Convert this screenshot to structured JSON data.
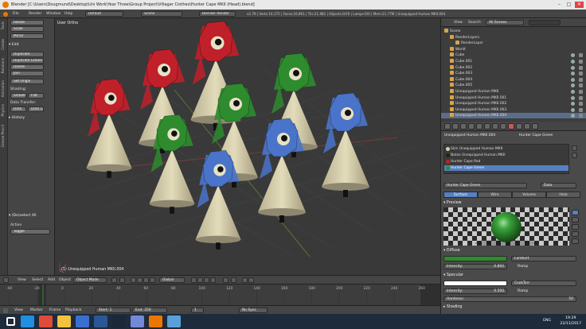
{
  "window": {
    "title": "Blender [C:\\Users\\Dougmund\\Desktop\\Uni Work\\Year Three\\Group Project\\Villager Clothes\\Hunter Cape MKII (Head).blend]",
    "controls": [
      "–",
      "□",
      "✕"
    ]
  },
  "info_header": {
    "menus": [
      "File",
      "Render",
      "Window",
      "Help"
    ],
    "layout": "Default",
    "scene": "Scene",
    "engine": "Blender Render",
    "stats": "v2.79 | Verts:10,175 | Faces:10,961 | Tris:21,981 | Objects:0/19 | Lamps:0/0 | Mem:21.77M | Unequipped Human MKII.004"
  },
  "tool_shelf": {
    "tabs": [
      "Tools",
      "Create",
      "Relations",
      "Animation",
      "Physics",
      "Grease Pencil"
    ],
    "transform_buttons": [
      "Rotate",
      "Scale",
      "Mirror"
    ],
    "edit_section": "▾ Edit",
    "edit_buttons": [
      "Duplicate",
      "Duplicate Linked",
      "Delete",
      "Join"
    ],
    "set_origin": "Set Origin",
    "shading_label": "Shading:",
    "shading_buttons": [
      "Smooth",
      "Flat"
    ],
    "data_transfer_label": "Data Transfer:",
    "data_buttons": [
      "Data",
      "Data Lay"
    ],
    "history": "▸ History",
    "operator_section": "▾ (De)select All",
    "action_label": "Action",
    "action_value": "Toggle"
  },
  "viewport": {
    "view_label": "User Ortho",
    "object_label": "(1) Unequipped Human MKII.004"
  },
  "viewport_header": {
    "menus": [
      "View",
      "Select",
      "Add",
      "Object"
    ],
    "mode": "Object Mode",
    "pivot": "Global"
  },
  "timeline": {
    "ticks": [
      "-40",
      "-20",
      "0",
      "20",
      "40",
      "60",
      "80",
      "100",
      "120",
      "140",
      "160",
      "180",
      "200",
      "220",
      "240",
      "260"
    ],
    "current_frame": "1"
  },
  "timeline_header": {
    "menus": [
      "View",
      "Marker",
      "Frame",
      "Playback"
    ],
    "start": "Start:",
    "start_val": "1",
    "end": "End:",
    "end_val": "250",
    "sync": "No Sync"
  },
  "outliner": {
    "menus": [
      "View",
      "Search"
    ],
    "filter": "All Scenes",
    "rows": [
      {
        "name": "Scene",
        "indent": 0
      },
      {
        "name": "RenderLayers",
        "indent": 1
      },
      {
        "name": "RenderLayer",
        "indent": 2
      },
      {
        "name": "World",
        "indent": 1
      },
      {
        "name": "Cube",
        "indent": 1
      },
      {
        "name": "Cube.001",
        "indent": 1
      },
      {
        "name": "Cube.002",
        "indent": 1
      },
      {
        "name": "Cube.003",
        "indent": 1
      },
      {
        "name": "Cube.004",
        "indent": 1
      },
      {
        "name": "Cube.005",
        "indent": 1
      },
      {
        "name": "Unequipped Human MKII",
        "indent": 1
      },
      {
        "name": "Unequipped Human MKII.001",
        "indent": 1
      },
      {
        "name": "Unequipped Human MKII.002",
        "indent": 1
      },
      {
        "name": "Unequipped Human MKII.003",
        "indent": 1
      },
      {
        "name": "Unequipped Human MKII.004",
        "indent": 1
      }
    ]
  },
  "properties": {
    "context_path": [
      "Unequipped Human MKII.004",
      "Hunter Cape Green"
    ],
    "materials": [
      {
        "name": "Skin Unequipped Human MKII",
        "color": "#d9cfa6"
      },
      {
        "name": "Notes Unequipped Human MKII",
        "color": "#222222"
      },
      {
        "name": "Hunter Cape Red",
        "color": "#c0202a"
      },
      {
        "name": "Hunter Cape Green",
        "color": "#2e8b2e"
      }
    ],
    "active_material": "Hunter Cape Green",
    "data_button": "Data",
    "tabs": [
      "Surface",
      "Wire",
      "Volume",
      "Halo"
    ],
    "preview_label": "▾ Preview",
    "diffuse_label": "▾ Diffuse",
    "diffuse_color": "#2e8b2e",
    "diffuse_shader": "Lambert",
    "diffuse_intensity_label": "Intensity:",
    "diffuse_intensity": "0.800",
    "ramp_label": "Ramp",
    "specular_label": "▾ Specular",
    "specular_shader": "CookTorr",
    "specular_intensity_label": "Intensity:",
    "specular_intensity": "0.500",
    "hardness_label": "Hardness:",
    "hardness": "50",
    "shading_label": "▸ Shading"
  },
  "taskbar": {
    "lang": "ENG",
    "time": "19:29",
    "date": "22/11/2017",
    "icons": [
      "windows-start-icon",
      "ie-icon",
      "chrome-icon",
      "explorer-icon",
      "store-icon",
      "word-icon",
      "steam-icon",
      "discord-icon",
      "blender-icon",
      "other-icon"
    ]
  },
  "colors": {
    "accent_blue": "#5680c2",
    "cape_red": "#c0202a",
    "cape_green": "#2e8b2e",
    "cape_blue": "#4a74c9",
    "body": "#d6cfa8"
  }
}
